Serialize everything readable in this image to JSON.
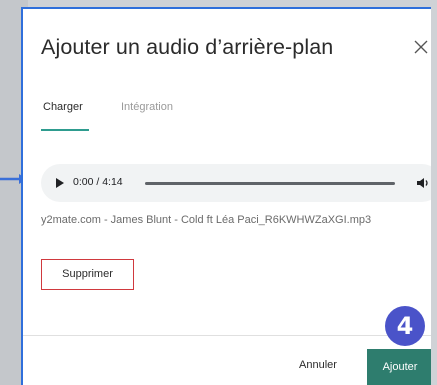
{
  "dialog": {
    "title": "Ajouter un audio d’arrière-plan",
    "close_icon": "close-icon"
  },
  "tabs": [
    {
      "label": "Charger",
      "active": true
    },
    {
      "label": "Intégration",
      "active": false
    }
  ],
  "player": {
    "time": "0:00 / 4:14",
    "progress": 0.0,
    "play_icon": "play-icon",
    "volume_icon": "volume-icon"
  },
  "file": {
    "name": "y2mate.com - James Blunt - Cold ft Léa Paci_R6KWHWZaXGI.mp3"
  },
  "actions": {
    "delete_label": "Supprimer",
    "cancel_label": "Annuler",
    "add_label": "Ajouter"
  },
  "annotation": {
    "step_number": "4",
    "arrow_icon": "arrow-right-icon"
  },
  "colors": {
    "accent": "#2e9c8f",
    "primary_button": "#2e7d6e",
    "danger_border": "#d0393e",
    "badge": "#4a53c9",
    "dialog_border": "#2f6fdb"
  }
}
